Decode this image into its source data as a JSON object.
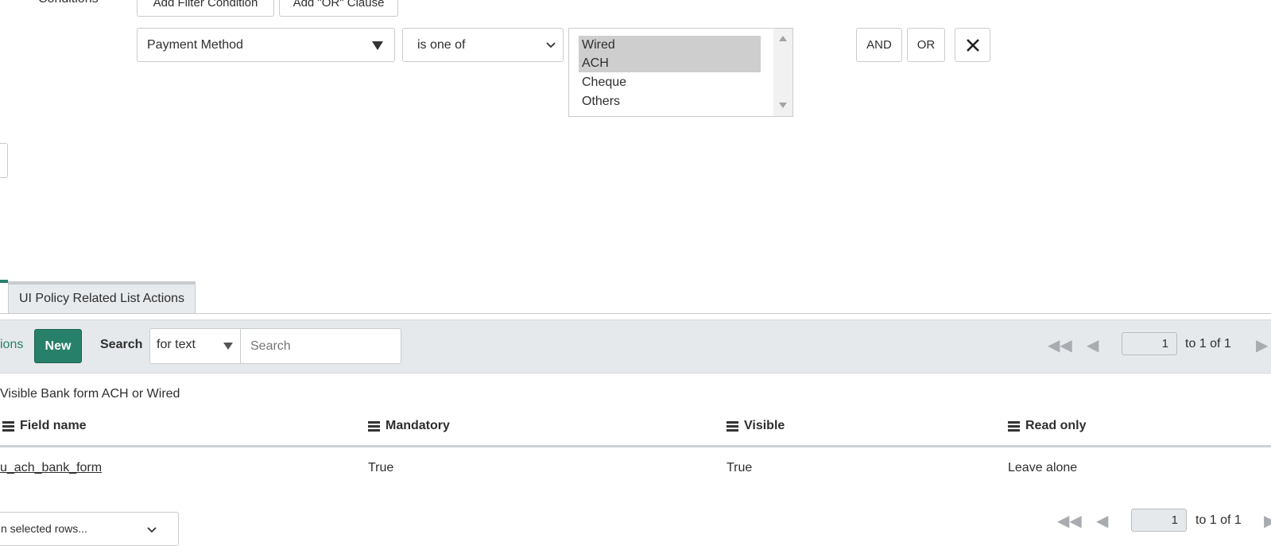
{
  "filter": {
    "conditions_label": "Conditions",
    "add_filter_condition": "Add Filter Condition",
    "add_or_clause": "Add \"OR\" Clause",
    "field": "Payment Method",
    "operator": "is one of",
    "options": [
      {
        "label": "Wired",
        "selected": true
      },
      {
        "label": "ACH",
        "selected": true
      },
      {
        "label": "Cheque",
        "selected": false
      },
      {
        "label": "Others",
        "selected": false
      }
    ],
    "and_label": "AND",
    "or_label": "OR",
    "remove_icon": "close-icon"
  },
  "tabs": {
    "active_tab": "UI Policy Related List Actions"
  },
  "toolbar": {
    "actions_label": "ions",
    "new_label": "New",
    "search_label": "Search",
    "search_scope": "for text",
    "search_placeholder": "Search",
    "page_value": "1",
    "page_text": "to 1 of 1"
  },
  "list": {
    "breadcrumb": "Visible Bank form ACH or Wired",
    "columns": [
      "Field name",
      "Mandatory",
      "Visible",
      "Read only"
    ],
    "rows": [
      {
        "field_name": "u_ach_bank_form",
        "mandatory": "True",
        "visible": "True",
        "read_only": "Leave alone"
      }
    ]
  },
  "footer": {
    "bulk_action": "n selected rows...",
    "page_value": "1",
    "page_text": "to 1 of 1"
  },
  "colors": {
    "accent": "#278069",
    "toolbar_bg": "#e6e9ec",
    "selected_option": "#cecece"
  }
}
